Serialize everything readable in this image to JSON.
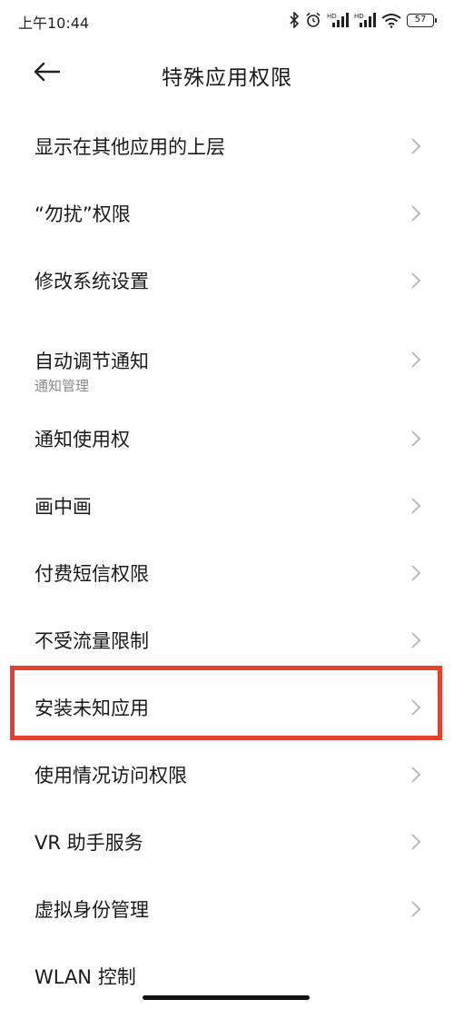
{
  "status_bar": {
    "time": "上午10:44",
    "battery": "57",
    "icons": [
      "bluetooth-icon",
      "alarm-icon",
      "hd-signal-icon",
      "hd-signal-icon",
      "wifi-icon",
      "battery-icon"
    ]
  },
  "header": {
    "title": "特殊应用权限",
    "back_icon": "arrow-left-icon"
  },
  "items": [
    {
      "label": "显示在其他应用的上层"
    },
    {
      "label": "“勿扰”权限"
    },
    {
      "label": "修改系统设置"
    },
    {
      "label": "自动调节通知",
      "subtitle": "通知管理"
    },
    {
      "label": "通知使用权"
    },
    {
      "label": "画中画"
    },
    {
      "label": "付费短信权限"
    },
    {
      "label": "不受流量限制"
    },
    {
      "label": "安装未知应用",
      "highlighted": true
    },
    {
      "label": "使用情况访问权限"
    },
    {
      "label": "VR 助手服务"
    },
    {
      "label": "虚拟身份管理"
    },
    {
      "label": "WLAN 控制"
    }
  ],
  "colors": {
    "highlight": "#e8402e",
    "chevron": "#b5b5b5",
    "subtitle": "#8a8a8a"
  }
}
